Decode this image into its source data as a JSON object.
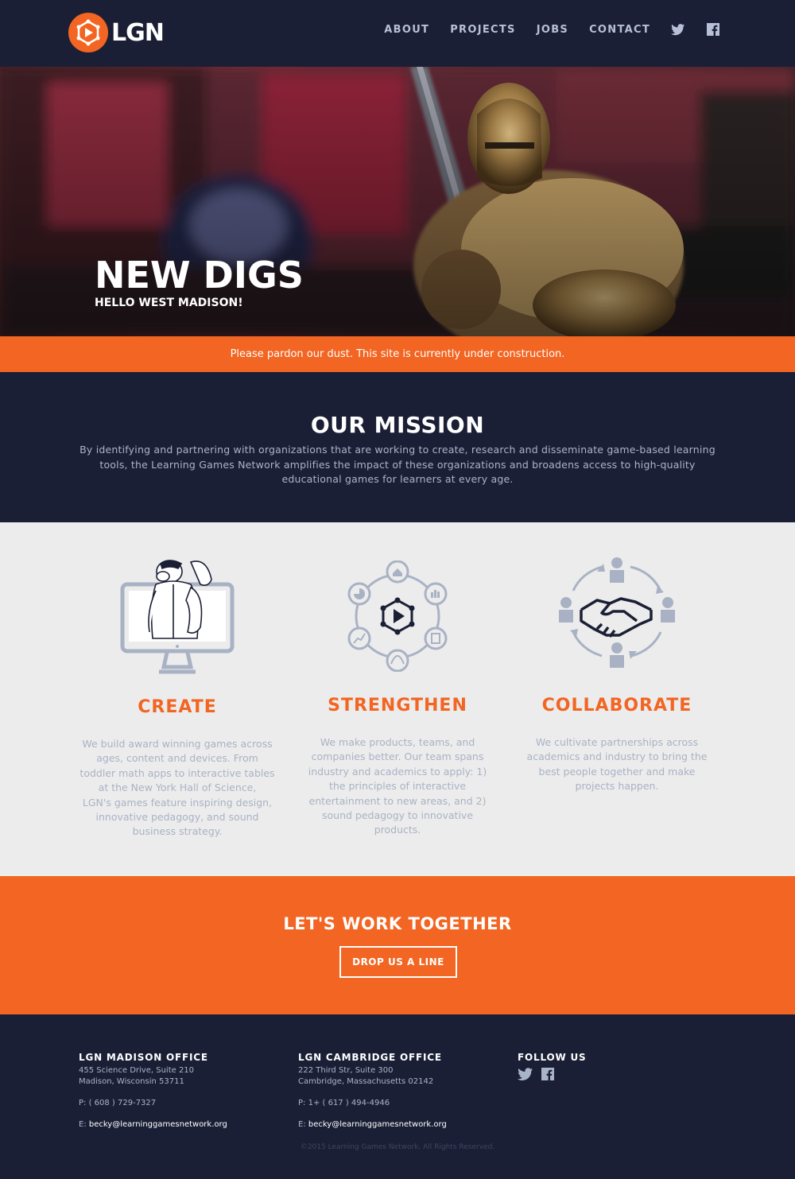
{
  "brand": {
    "name": "LGN",
    "accent": "#f26522",
    "navy": "#1b1f35"
  },
  "nav": {
    "links": [
      "ABOUT",
      "PROJECTS",
      "JOBS",
      "CONTACT"
    ],
    "icons": [
      "twitter-icon",
      "facebook-icon"
    ]
  },
  "hero": {
    "title": "NEW DIGS",
    "subtitle": "HELLO WEST MADISON!"
  },
  "banner": {
    "text": "Please pardon our dust. This site is currently under construction."
  },
  "mission": {
    "title": "OUR MISSION",
    "line1": "By identifying and partnering with organizations that are working to create, research and disseminate game-based learning",
    "line2": "tools, the Learning Games Network amplifies the impact of these organizations and broadens access to high-quality",
    "line3": "educational games for learners at every age."
  },
  "features": [
    {
      "title": "CREATE",
      "icon": "monitor-character-icon",
      "lines": [
        "We build award winning games across",
        "ages, content and devices. From",
        "toddler math apps to interactive tables",
        "at the New York Hall of Science,",
        "LGN's games feature inspiring design,",
        "innovative pedagogy, and sound",
        "business strategy."
      ]
    },
    {
      "title": "STRENGTHEN",
      "icon": "network-hub-icon",
      "lines": [
        "We make products, teams, and",
        "companies better. Our team spans",
        "industry and academics to apply: 1)",
        "the principles of interactive",
        "entertainment to new areas, and 2)",
        "sound pedagogy to innovative",
        "products."
      ]
    },
    {
      "title": "COLLABORATE",
      "icon": "handshake-icon",
      "lines": [
        "We cultivate partnerships across",
        "academics and industry to bring the",
        "best people together and make",
        "projects happen."
      ]
    }
  ],
  "cta": {
    "title": "LET'S WORK TOGETHER",
    "button": "DROP US A LINE"
  },
  "footer": {
    "madison": {
      "title": "LGN MADISON OFFICE",
      "address1": "455 Science Drive, Suite 210",
      "address2": "Madison, Wisconsin 53711",
      "phone": "P: ( 608 ) 729-7327",
      "email_prefix": "E: ",
      "email": "becky@learninggamesnetwork.org"
    },
    "cambridge": {
      "title": "LGN CAMBRIDGE OFFICE",
      "address1": "222 Third Str, Suite 300",
      "address2": "Cambridge, Massachusetts 02142",
      "phone": "P: 1+ ( 617 ) 494-4946",
      "email_prefix": "E: ",
      "email": "becky@learninggamesnetwork.org"
    },
    "follow": {
      "title": "FOLLOW US",
      "icons": [
        "twitter-icon",
        "facebook-icon"
      ]
    },
    "copyright": "©2015 Learning Games Network. All Rights Reserved."
  }
}
